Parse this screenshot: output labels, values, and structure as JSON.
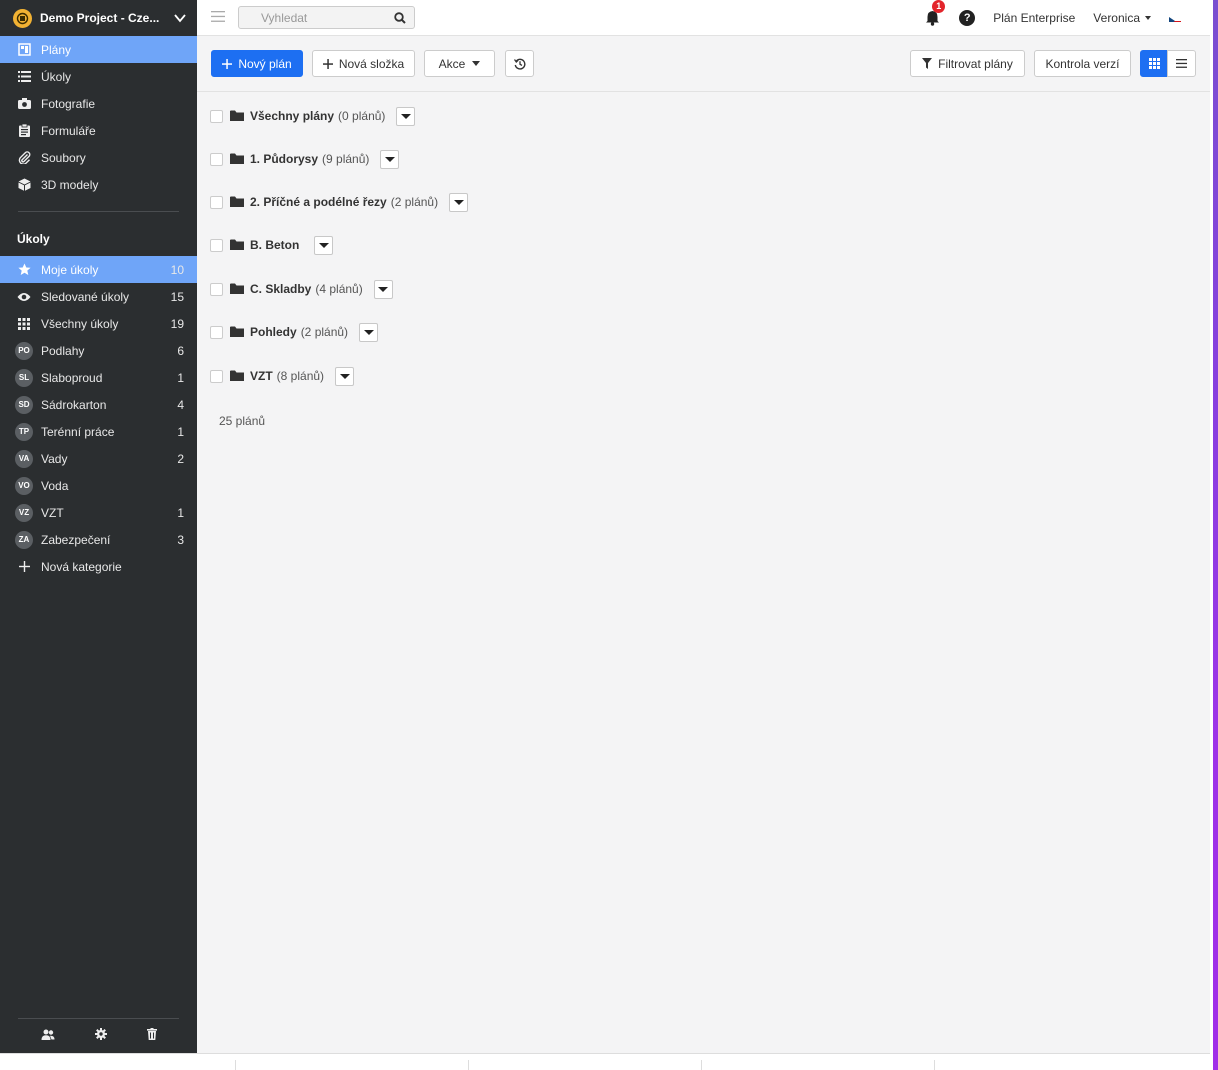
{
  "project": {
    "name": "Demo Project - Cze...",
    "logo_icon": "project-logo-icon"
  },
  "nav": [
    {
      "label": "Plány",
      "icon": "plans-icon",
      "active": true
    },
    {
      "label": "Úkoly",
      "icon": "list-icon"
    },
    {
      "label": "Fotografie",
      "icon": "camera-icon"
    },
    {
      "label": "Formuláře",
      "icon": "clipboard-icon"
    },
    {
      "label": "Soubory",
      "icon": "paperclip-icon"
    },
    {
      "label": "3D modely",
      "icon": "cube-icon"
    }
  ],
  "tasks_section": {
    "title": "Úkoly",
    "items": [
      {
        "label": "Moje úkoly",
        "count": "10",
        "icon": "star-icon",
        "active": true
      },
      {
        "label": "Sledované úkoly",
        "count": "15",
        "icon": "eye-icon"
      },
      {
        "label": "Všechny úkoly",
        "count": "19",
        "icon": "grid-icon"
      },
      {
        "label": "Podlahy",
        "count": "6",
        "abbr": "PO"
      },
      {
        "label": "Slaboproud",
        "count": "1",
        "abbr": "SL"
      },
      {
        "label": "Sádrokarton",
        "count": "4",
        "abbr": "SD"
      },
      {
        "label": "Terénní práce",
        "count": "1",
        "abbr": "TP"
      },
      {
        "label": "Vady",
        "count": "2",
        "abbr": "VA"
      },
      {
        "label": "Voda",
        "count": "",
        "abbr": "VO"
      },
      {
        "label": "VZT",
        "count": "1",
        "abbr": "VZ"
      },
      {
        "label": "Zabezpečení",
        "count": "3",
        "abbr": "ZA"
      }
    ],
    "new_category": "Nová kategorie"
  },
  "topbar": {
    "search_placeholder": "Vyhledat",
    "notifications": "1",
    "help": "?",
    "plan_label": "Plán Enterprise",
    "user": "Veronica"
  },
  "toolbar": {
    "new_plan": "Nový plán",
    "new_folder": "Nová složka",
    "actions": "Akce",
    "filter": "Filtrovat plány",
    "version_check": "Kontrola verzí"
  },
  "folders": [
    {
      "name": "Všechny plány",
      "count": "(0 plánů)"
    },
    {
      "name": "1. Půdorysy",
      "count": "(9 plánů)"
    },
    {
      "name": "2. Příčné a podélné řezy",
      "count": "(2 plánů)"
    },
    {
      "name": "B. Beton",
      "count": ""
    },
    {
      "name": "C. Skladby",
      "count": "(4 plánů)"
    },
    {
      "name": "Pohledy",
      "count": "(2 plánů)"
    },
    {
      "name": "VZT",
      "count": "(8 plánů)"
    }
  ],
  "total": "25 plánů",
  "colors": {
    "primary": "#1d6ff2",
    "sidebar": "#2b2e30",
    "active_nav": "#6fa5f8",
    "badge": "#e3252b"
  }
}
